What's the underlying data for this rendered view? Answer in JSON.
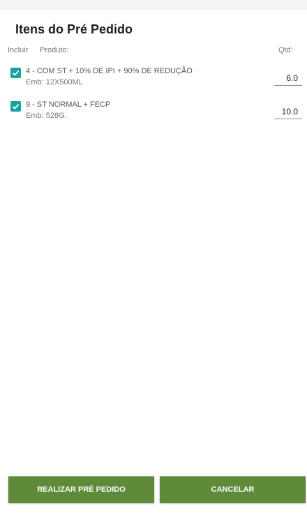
{
  "dialog": {
    "title": "Itens do Pré Pedido"
  },
  "columns": {
    "incluir": "Incluir",
    "produto": "Produto:",
    "qtd": "Qtd:"
  },
  "items": [
    {
      "checked": true,
      "name": "4 - COM ST + 10% DE IPI + 90% DE REDUÇÃO",
      "emb": "Emb: 12X500ML",
      "qty": "6.0"
    },
    {
      "checked": true,
      "name": "9 - ST NORMAL + FECP",
      "emb": "Emb: 528G.",
      "qty": "10.0"
    }
  ],
  "buttons": {
    "realizar": "REALIZAR PRÉ PEDIDO",
    "cancelar": "CANCELAR"
  },
  "colors": {
    "checkbox": "#16a398",
    "button": "#5e8a3a"
  }
}
